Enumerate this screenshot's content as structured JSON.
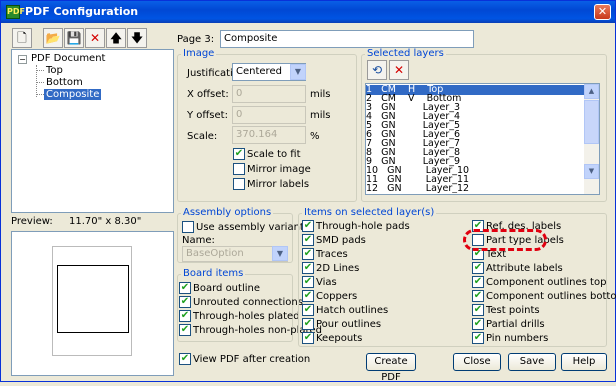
{
  "window": {
    "title": "PDF Configuration",
    "close_glyph": "✕",
    "app_icon_text": "PDF"
  },
  "toolbar": [
    {
      "name": "new-icon",
      "glyph": "🗋"
    },
    {
      "name": "open-icon",
      "glyph": "📂"
    },
    {
      "name": "save-icon",
      "glyph": "💾"
    },
    {
      "name": "delete-icon",
      "glyph": "✕"
    },
    {
      "name": "move-up-icon",
      "glyph": "🡅"
    },
    {
      "name": "move-down-icon",
      "glyph": "🡇"
    }
  ],
  "tree": {
    "root": "PDF Document",
    "children": [
      "Top",
      "Bottom",
      "Composite"
    ],
    "selected": "Composite"
  },
  "page": {
    "label": "Page 3:",
    "value": "Composite"
  },
  "preview": {
    "label": "Preview:",
    "size": "11.70\" x 8.30\""
  },
  "image": {
    "title": "Image",
    "justification_label": "Justification:",
    "justification_value": "Centered",
    "x_offset_label": "X offset:",
    "x_offset_value": "0",
    "y_offset_label": "Y offset:",
    "y_offset_value": "0",
    "unit": "mils",
    "scale_label": "Scale:",
    "scale_value": "370.164",
    "scale_unit": "%",
    "options": [
      {
        "label": "Scale to fit",
        "checked": true
      },
      {
        "label": "Mirror image",
        "checked": false
      },
      {
        "label": "Mirror labels",
        "checked": false
      }
    ]
  },
  "selected_layers": {
    "title": "Selected layers",
    "rows": [
      "1   CM    H    Top",
      "2   CM    V    Bottom",
      "3   GN         Layer_3",
      "4   GN         Layer_4",
      "5   GN         Layer_5",
      "6   GN         Layer_6",
      "7   GN         Layer_7",
      "8   GN         Layer_8",
      "9   GN         Layer_9",
      "10   GN        Layer_10",
      "11   GN        Layer_11",
      "12   GN        Layer_12"
    ]
  },
  "assembly": {
    "title": "Assembly options",
    "use_variant": "Use assembly variant",
    "name_label": "Name:",
    "name_value": "BaseOption"
  },
  "board_items": {
    "title": "Board items",
    "items": [
      "Board outline",
      "Unrouted connections",
      "Through-holes plated",
      "Through-holes non-plated"
    ]
  },
  "items_on_layers": {
    "title": "Items on selected layer(s)",
    "col1": [
      "Through-hole pads",
      "SMD pads",
      "Traces",
      "2D Lines",
      "Vias",
      "Coppers",
      "Hatch outlines",
      "Pour outlines",
      "Keepouts"
    ],
    "col2": [
      "Ref. des. labels",
      "Part type labels",
      "Text",
      "Attribute labels",
      "Component outlines top",
      "Component outlines bottom",
      "Test points",
      "Partial drills",
      "Pin numbers"
    ],
    "unchecked": "Part type labels"
  },
  "view_pdf": "View PDF after creation",
  "buttons": {
    "create_pdf": "Create PDF",
    "close": "Close",
    "save": "Save",
    "help": "Help"
  },
  "check_glyph": "✔",
  "layer_tools": {
    "refresh": "⟲",
    "remove": "✕"
  },
  "dropdown_arrow": "▼",
  "scroll": {
    "up": "▲",
    "down": "▼",
    "left": "◀",
    "right": "▶"
  },
  "tree_expander": "−"
}
